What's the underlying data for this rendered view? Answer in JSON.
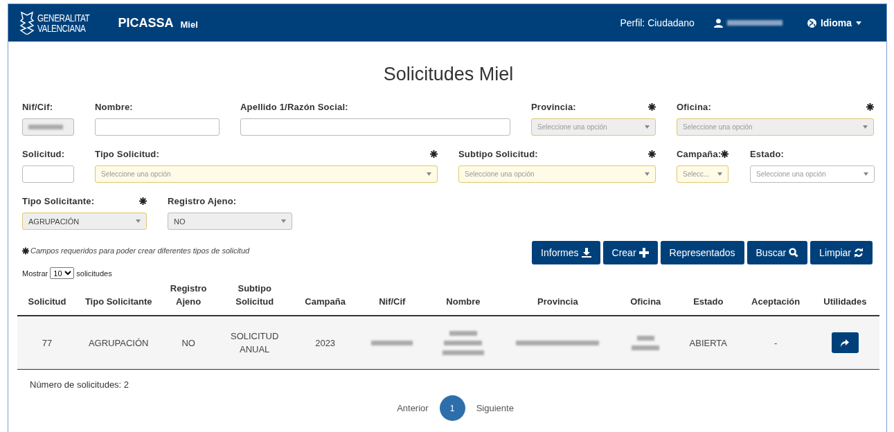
{
  "header": {
    "logo_lines": [
      "GENERALITAT",
      "VALENCIANA"
    ],
    "app_name": "PICASSA",
    "module": "Miel",
    "profile": "Perfil: Ciudadano",
    "user": {
      "redacted": true
    },
    "language": "Idioma"
  },
  "title": "Solicitudes Miel",
  "filter_rows": [
    [
      {
        "kind": "text",
        "label": "Nif/Cif:",
        "required": false,
        "disabled": true,
        "redacted": true
      },
      {
        "kind": "text",
        "label": "Nombre:",
        "required": false,
        "disabled": false
      },
      {
        "kind": "text",
        "label": "Apellido 1/Razón Social:",
        "required": false,
        "disabled": false
      },
      {
        "kind": "select",
        "label": "Provincia:",
        "required": true,
        "disabled": true,
        "placeholder": "Seleccione una opción"
      },
      {
        "kind": "select",
        "label": "Oficina:",
        "required": true,
        "disabled": true,
        "placeholder": "Seleccione una opción"
      }
    ],
    [
      {
        "kind": "text",
        "label": "Solicitud:",
        "required": false,
        "disabled": false
      },
      {
        "kind": "select",
        "label": "Tipo Solicitud:",
        "required": true,
        "disabled": false,
        "placeholder": "Seleccione una opción"
      },
      {
        "kind": "select",
        "label": "Subtipo Solicitud:",
        "required": true,
        "disabled": false,
        "placeholder": "Seleccione una opción"
      },
      {
        "kind": "select",
        "label": "Campaña:",
        "required": true,
        "disabled": false,
        "placeholder": "Selecc..."
      },
      {
        "kind": "select",
        "label": "Estado:",
        "required": false,
        "disabled": false,
        "placeholder": "Seleccione una opción"
      }
    ],
    [
      {
        "kind": "select",
        "label": "Tipo Solicitante:",
        "required": true,
        "disabled": true,
        "value": "AGRUPACIÓN"
      },
      {
        "kind": "select",
        "label": "Registro Ajeno:",
        "required": false,
        "disabled": true,
        "value": "NO"
      }
    ]
  ],
  "required_note": "Campos requeridos para poder crear diferentes tipos de solicitud",
  "buttons": [
    {
      "label": "Informes"
    },
    {
      "label": "Crear"
    },
    {
      "label": "Representados"
    },
    {
      "label": "Buscar"
    },
    {
      "label": "Limpiar"
    }
  ],
  "page_size": {
    "before": "Mostrar",
    "value": "10",
    "after": "solicitudes"
  },
  "table": {
    "columns": [
      "Solicitud",
      "Tipo Solicitante",
      "Registro Ajeno",
      "Subtipo Solicitud",
      "Campaña",
      "Nif/Cif",
      "Nombre",
      "Provincia",
      "Oficina",
      "Estado",
      "Aceptación",
      "Utilidades"
    ],
    "rows": [
      [
        {
          "kind": "text",
          "text": "77"
        },
        {
          "kind": "text",
          "text": "AGRUPACIÓN"
        },
        {
          "kind": "text",
          "text": "NO"
        },
        {
          "kind": "text",
          "text": "SOLICITUD ANUAL"
        },
        {
          "kind": "text",
          "text": "2023"
        },
        {
          "kind": "redacted"
        },
        {
          "kind": "redacted"
        },
        {
          "kind": "redacted"
        },
        {
          "kind": "redacted"
        },
        {
          "kind": "text",
          "text": "ABIERTA"
        },
        {
          "kind": "text",
          "text": "-"
        },
        {
          "kind": "action"
        }
      ]
    ]
  },
  "count": "Número de solicitudes: 2",
  "pager": [
    {
      "kind": "link",
      "label": "Anterior"
    },
    {
      "kind": "page",
      "label": "1",
      "selected": true
    },
    {
      "kind": "link",
      "label": "Siguiente"
    }
  ]
}
